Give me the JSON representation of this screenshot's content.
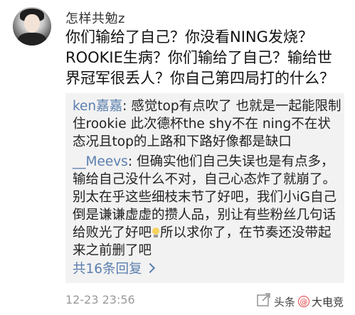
{
  "post": {
    "username": "怎样共勉z",
    "text": "你们输给了自己？你没看NING发烧？ROOKIE生病？你们输给了自己？输给世界冠军很丢人？你自己第四局打的什么？"
  },
  "replies": [
    {
      "author": "ken嘉嘉",
      "separator": ": ",
      "text": "感觉top有点吹了  也就是一起能限制住rookie 此次德杯the shy不在  ning不在状态况且top的上路和下路好像都是缺口"
    },
    {
      "author": "__Meevs",
      "separator": ": ",
      "text_before_icon": "但确实他们自己失误也是有点多，输给自己没什么不对，自己心态炸了就崩了。别太在乎这些细枝末节了好吧，我们小iG自己倒是谦谦虚虚的攒人品，别让有些粉丝几句话给败光了好吧",
      "icon": "lightbulb-emoji",
      "text_after_icon": "所以求你了，在节奏还没带起来之前删了吧"
    }
  ],
  "view_all": "共16条回复",
  "timestamp": "12-23 23:56",
  "watermark": {
    "platform": "头条",
    "at": "@",
    "name": "大电竞"
  },
  "icons": {
    "avatar": "user-avatar",
    "share": "share-icon",
    "comment": "comment-icon",
    "chevron": "chevron-right-icon"
  },
  "colors": {
    "link": "#5b7fae",
    "reply_bg": "#f2f2f2",
    "meta": "#9a9a9a",
    "text": "#111111"
  }
}
